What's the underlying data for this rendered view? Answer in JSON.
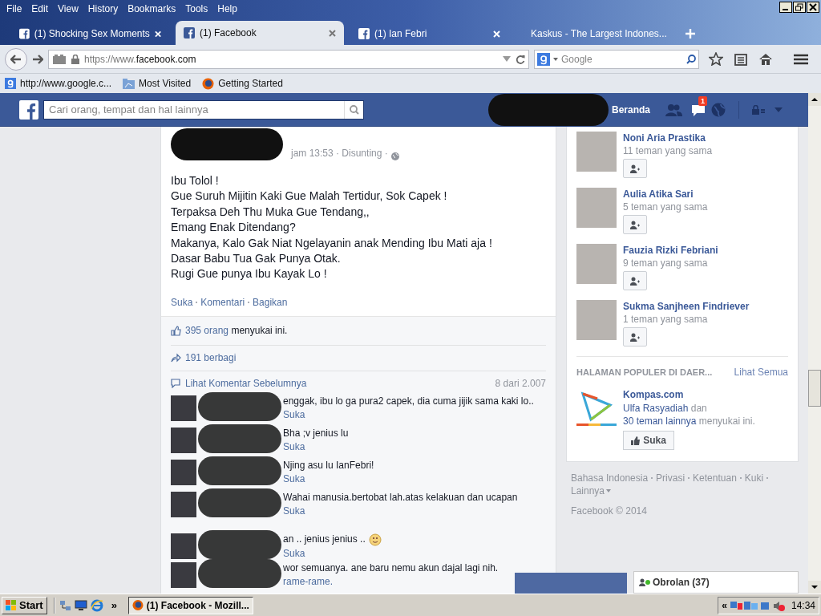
{
  "menu_bar": [
    "File",
    "Edit",
    "View",
    "History",
    "Bookmarks",
    "Tools",
    "Help"
  ],
  "tabs": [
    {
      "label": "(1) Shocking Sex Moments",
      "kind": "facebook",
      "selected": false
    },
    {
      "label": "(1) Facebook",
      "kind": "facebook",
      "selected": true
    },
    {
      "label": "(1) Ian Febri",
      "kind": "facebook",
      "selected": false
    },
    {
      "label": "Kaskus - The Largest Indones...",
      "kind": "site",
      "selected": false
    }
  ],
  "address_bar": {
    "prefix": "https://www.",
    "domain": "facebook.com"
  },
  "search_box": {
    "placeholder": "Google"
  },
  "bookmarks": [
    {
      "label": "http://www.google.c...",
      "kind": "google"
    },
    {
      "label": "Most Visited",
      "kind": "folder"
    },
    {
      "label": "Getting Started",
      "kind": "firefox"
    }
  ],
  "fb_header": {
    "search_placeholder": "Cari orang, tempat dan hal lainnya",
    "home": "Beranda",
    "message_badge": "1"
  },
  "post": {
    "meta": "jam 13:53 · Disunting ·",
    "lines": [
      "Ibu Tolol !",
      "Gue Suruh Mijitin Kaki Gue Malah Tertidur, Sok Capek !",
      "Terpaksa Deh Thu Muka Gue Tendang,,",
      "Emang Enak Ditendang?",
      "Makanya, Kalo Gak Niat Ngelayanin anak Mending Ibu Mati aja !",
      "Dasar Babu Tua Gak Punya Otak.",
      "Rugi Gue punya Ibu Kayak Lo !"
    ],
    "actions": [
      "Suka",
      "Komentari",
      "Bagikan"
    ],
    "likes_link": "395 orang",
    "likes_rest": "menyukai ini.",
    "shares": "191 berbagi",
    "prev_comments": "Lihat Komentar Sebelumnya",
    "comment_count": "8 dari 2.007",
    "comments": [
      {
        "text": "enggak, ibu lo ga pura2 capek, dia cuma jijik sama kaki lo..",
        "action": "Suka",
        "emoji": false
      },
      {
        "text": "Bha ;v jenius lu",
        "action": "Suka",
        "emoji": false
      },
      {
        "text": "Njing asu lu IanFebri!",
        "action": "Suka",
        "emoji": false
      },
      {
        "text": "Wahai manusia.bertobat lah.atas kelakuan dan ucapan",
        "action": "Suka",
        "emoji": false
      },
      {
        "text": "an .. jenius jenius ..",
        "action": "Suka",
        "emoji": true
      },
      {
        "text": "wor semuanya. ane baru nemu akun dajal lagi nih.",
        "action": "rame-rame.",
        "emoji": false
      }
    ]
  },
  "suggestions": [
    {
      "name": "Noni Aria Prastika",
      "mutual": "11 teman yang sama"
    },
    {
      "name": "Aulia Atika Sari",
      "mutual": "5 teman yang sama"
    },
    {
      "name": "Fauzia Rizki Febriani",
      "mutual": "9 teman yang sama"
    },
    {
      "name": "Sukma Sanjheen Findriever",
      "mutual": "1 teman yang sama"
    }
  ],
  "popular_pages": {
    "heading": "HALAMAN POPULER DI DAER...",
    "see_all": "Lihat Semua",
    "page": "Kompas.com",
    "liker": "Ulfa Rasyadiah",
    "mid": "dan",
    "friends": "30 teman lainnya",
    "rest": "menyukai ini.",
    "like_button": "Suka"
  },
  "footer": {
    "links": [
      "Bahasa Indonesia",
      "Privasi",
      "Ketentuan",
      "Kuki",
      "Lainnya"
    ],
    "copyright": "Facebook © 2014"
  },
  "chat": {
    "label": "Obrolan (37)"
  },
  "taskbar": {
    "start": "Start",
    "more": "»",
    "task": "(1) Facebook - Mozill...",
    "tray_more": "«",
    "clock": "14:34"
  }
}
